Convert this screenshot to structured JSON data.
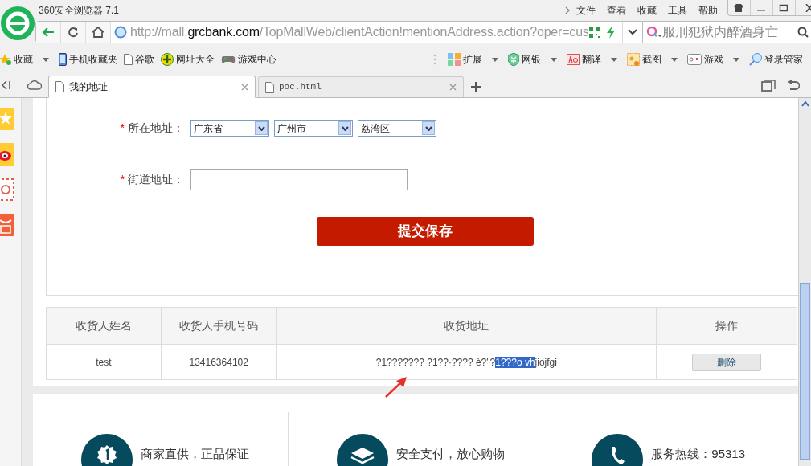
{
  "window": {
    "title": "360安全浏览器 7.1"
  },
  "menu": [
    "文件",
    "查看",
    "收藏",
    "工具",
    "帮助"
  ],
  "address_bar": {
    "url_prefix": "http://mall.",
    "url_domain": "grcbank.com",
    "url_rest": "/TopMallWeb/clientAction!mentionAddress.action?oper=cus"
  },
  "search": {
    "placeholder": "服刑犯狱内醉酒身亡"
  },
  "bookmarks": [
    {
      "label": "收藏",
      "kind": "star"
    },
    {
      "label": "手机收藏夹",
      "kind": "phone"
    },
    {
      "label": "谷歌",
      "kind": "page"
    },
    {
      "label": "网址大全",
      "kind": "plus"
    },
    {
      "label": "游戏中心",
      "kind": "gamepad"
    }
  ],
  "extensions": [
    {
      "label": "扩展",
      "kind": "grid"
    },
    {
      "label": "网银",
      "kind": "shield"
    },
    {
      "label": "翻译",
      "kind": "translate"
    },
    {
      "label": "截图",
      "kind": "capture"
    },
    {
      "label": "游戏",
      "kind": "game"
    },
    {
      "label": "登录管家",
      "kind": "key"
    }
  ],
  "tabs": [
    {
      "label": "我的地址",
      "selected": true
    },
    {
      "label": "poc.html",
      "selected": false
    }
  ],
  "form": {
    "fields": [
      {
        "label": "所在地址：",
        "required": true,
        "kind": "selects",
        "options": [
          "广东省",
          "广州市",
          "荔湾区"
        ]
      },
      {
        "label": "街道地址：",
        "required": true,
        "kind": "text"
      }
    ],
    "required_mark": "*",
    "submit": "提交保存"
  },
  "table": {
    "columns": [
      "收货人姓名",
      "收货人手机号码",
      "收货地址",
      "操作"
    ],
    "rows": [
      {
        "name": "test",
        "phone": "13416364102",
        "address_before": "?1??????? ?1??·???? è?\"?",
        "address_selected": "1???o vh",
        "address_after": "jiojfgi",
        "action": "删除"
      }
    ]
  },
  "features": [
    {
      "text": "商家直供，正品保证",
      "kind": "medal"
    },
    {
      "text": "安全支付，放心购物",
      "kind": "layers"
    },
    {
      "text": "服务热线：95313",
      "kind": "phone"
    }
  ]
}
